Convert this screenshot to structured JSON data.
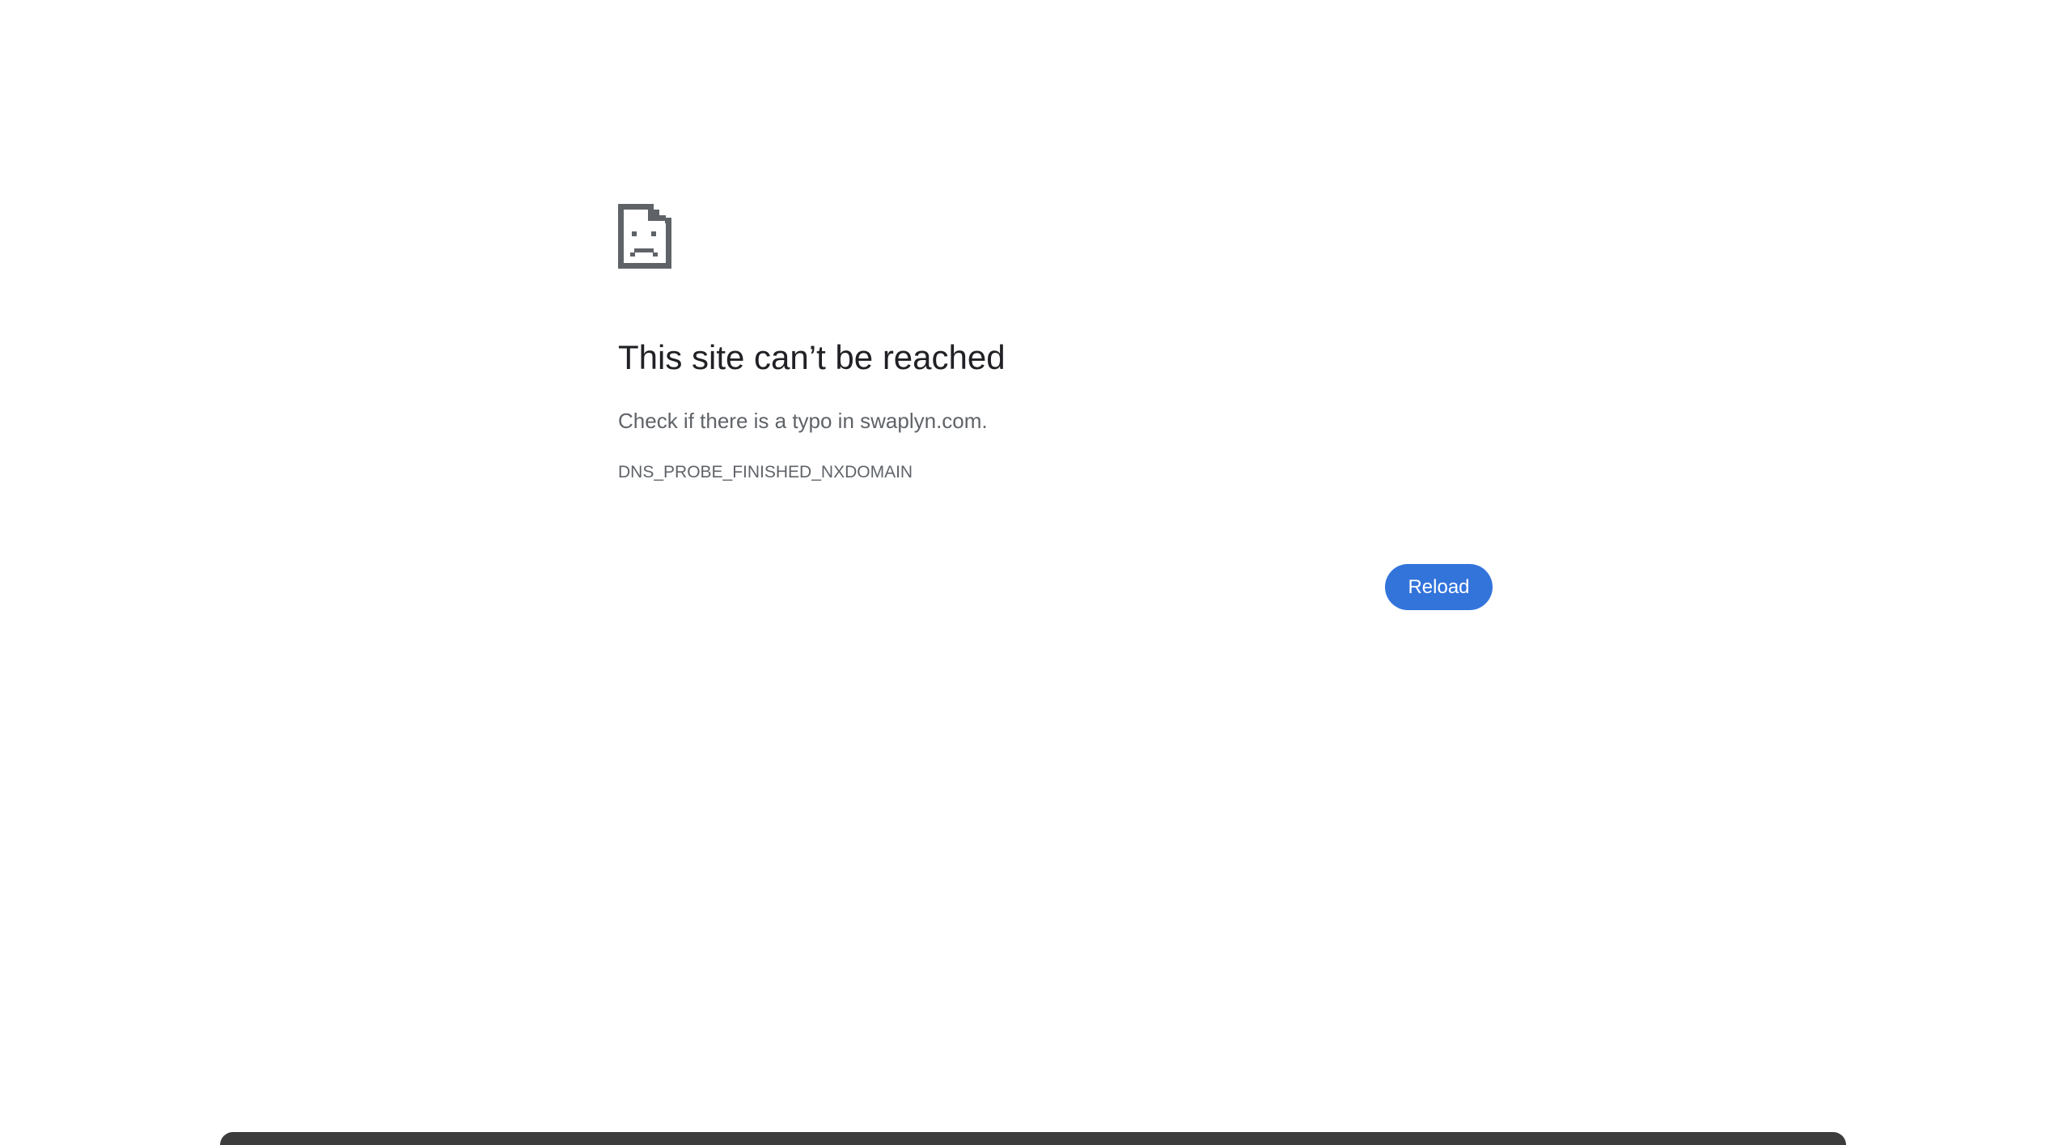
{
  "error_page": {
    "icon": "sad-document-icon",
    "title": "This site can’t be reached",
    "suggestion": "Check if there is a typo in swaplyn.com.",
    "error_code": "DNS_PROBE_FINISHED_NXDOMAIN",
    "reload_label": "Reload"
  },
  "colors": {
    "accent": "#3374db",
    "title_text": "#202124",
    "secondary_text": "#5f6368",
    "icon": "#5f6368",
    "background": "#ffffff"
  }
}
